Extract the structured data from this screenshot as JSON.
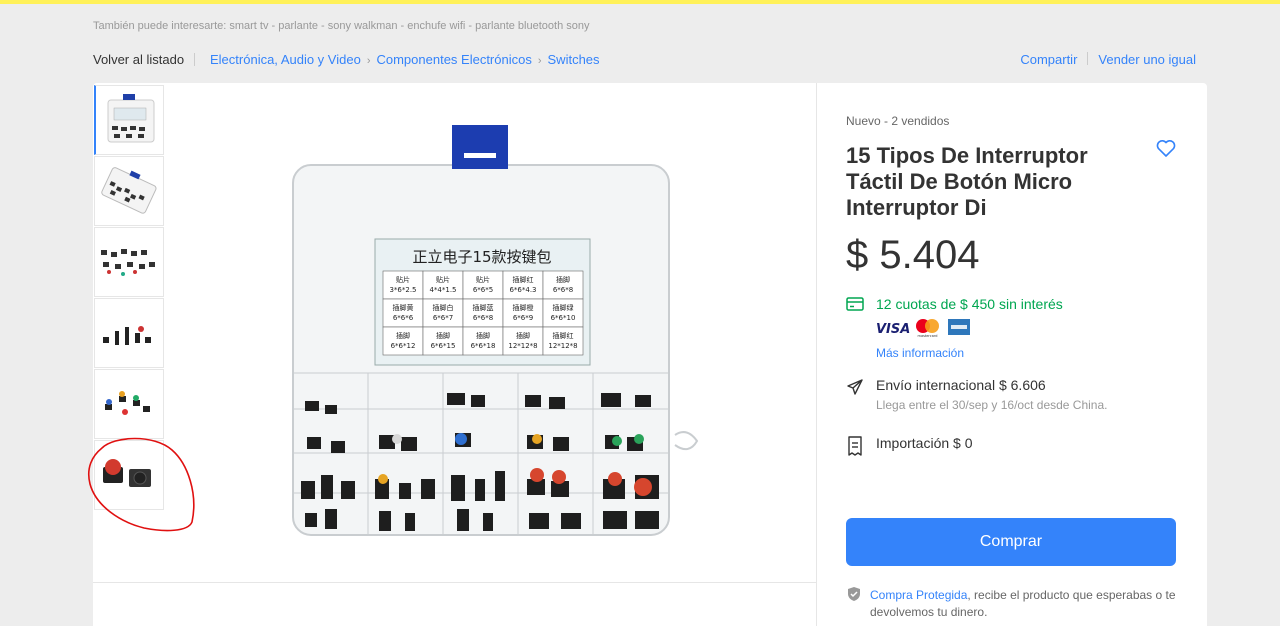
{
  "interests": "También puede interesarte: smart tv - parlante - sony walkman - enchufe wifi - parlante bluetooth sony",
  "nav": {
    "back_label": "Volver al listado",
    "breadcrumbs": [
      "Electrónica, Audio y Video",
      "Componentes Electrónicos",
      "Switches"
    ],
    "share_label": "Compartir",
    "sell_label": "Vender uno igual"
  },
  "product": {
    "condition": "Nuevo  -  2 vendidos",
    "title": "15 Tipos De Interruptor Táctil De Botón Micro Interruptor Di",
    "price": "$ 5.404",
    "installments": "12 cuotas de $ 450 sin interés",
    "payment_logos": [
      "VISA",
      "mastercard",
      "amex"
    ],
    "more_info": "Más información",
    "shipping": "Envío internacional $ 6.606",
    "shipping_eta": "Llega entre el 30/sep y 16/oct desde China.",
    "import_fee": "Importación $ 0",
    "buy_label": "Comprar",
    "protect_link": "Compra Protegida",
    "protect_text": ", recibe el producto que esperabas o te devolvemos tu dinero."
  },
  "box_label": {
    "title": "正立电子15款按键包",
    "cells": [
      [
        "贴片\n3*6*2.5",
        "贴片\n4*4*1.5",
        "贴片\n6*6*5",
        "插脚红\n6*6*4.3",
        "插脚\n6*6*8"
      ],
      [
        "插脚黄\n6*6*6",
        "插脚白\n6*6*7",
        "插脚蓝\n6*6*8",
        "插脚橙\n6*6*9",
        "插脚绿\n6*6*10"
      ],
      [
        "插脚\n6*6*12",
        "插脚\n6*6*15",
        "插脚\n6*6*18",
        "插脚\n12*12*8",
        "插脚红\n12*12*8"
      ]
    ]
  },
  "colors": {
    "accent": "#3483fa",
    "success": "#00a650",
    "topbar": "#fff159",
    "annotation": "#e01010"
  },
  "icons": {
    "favorite": "heart-outline-icon",
    "installments": "credit-card-icon",
    "shipping": "airplane-icon",
    "import": "receipt-icon",
    "protection": "shield-check-icon"
  }
}
